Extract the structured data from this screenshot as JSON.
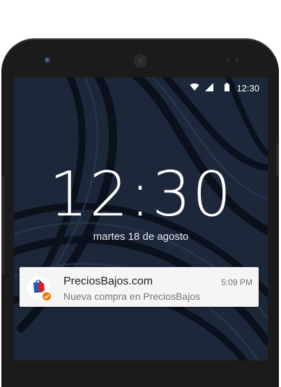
{
  "status_bar": {
    "time": "12:30",
    "icons": [
      "wifi-icon",
      "signal-icon",
      "battery-icon"
    ]
  },
  "lock_screen": {
    "clock": "12:30",
    "date": "martes 18 de agosto"
  },
  "notification": {
    "app_icon": "shopping-bag-icon",
    "badge_icon": "check-badge-icon",
    "title": "PreciosBajos.com",
    "text": "Nueva compra en PreciosBajos",
    "time": "5:09 PM"
  },
  "colors": {
    "wallpaper": "#1d2a3c",
    "notification_bg": "#f5f5f5",
    "bag_blue": "#1a5fb4",
    "bag_red": "#e01b24",
    "badge_orange": "#f57c00"
  }
}
